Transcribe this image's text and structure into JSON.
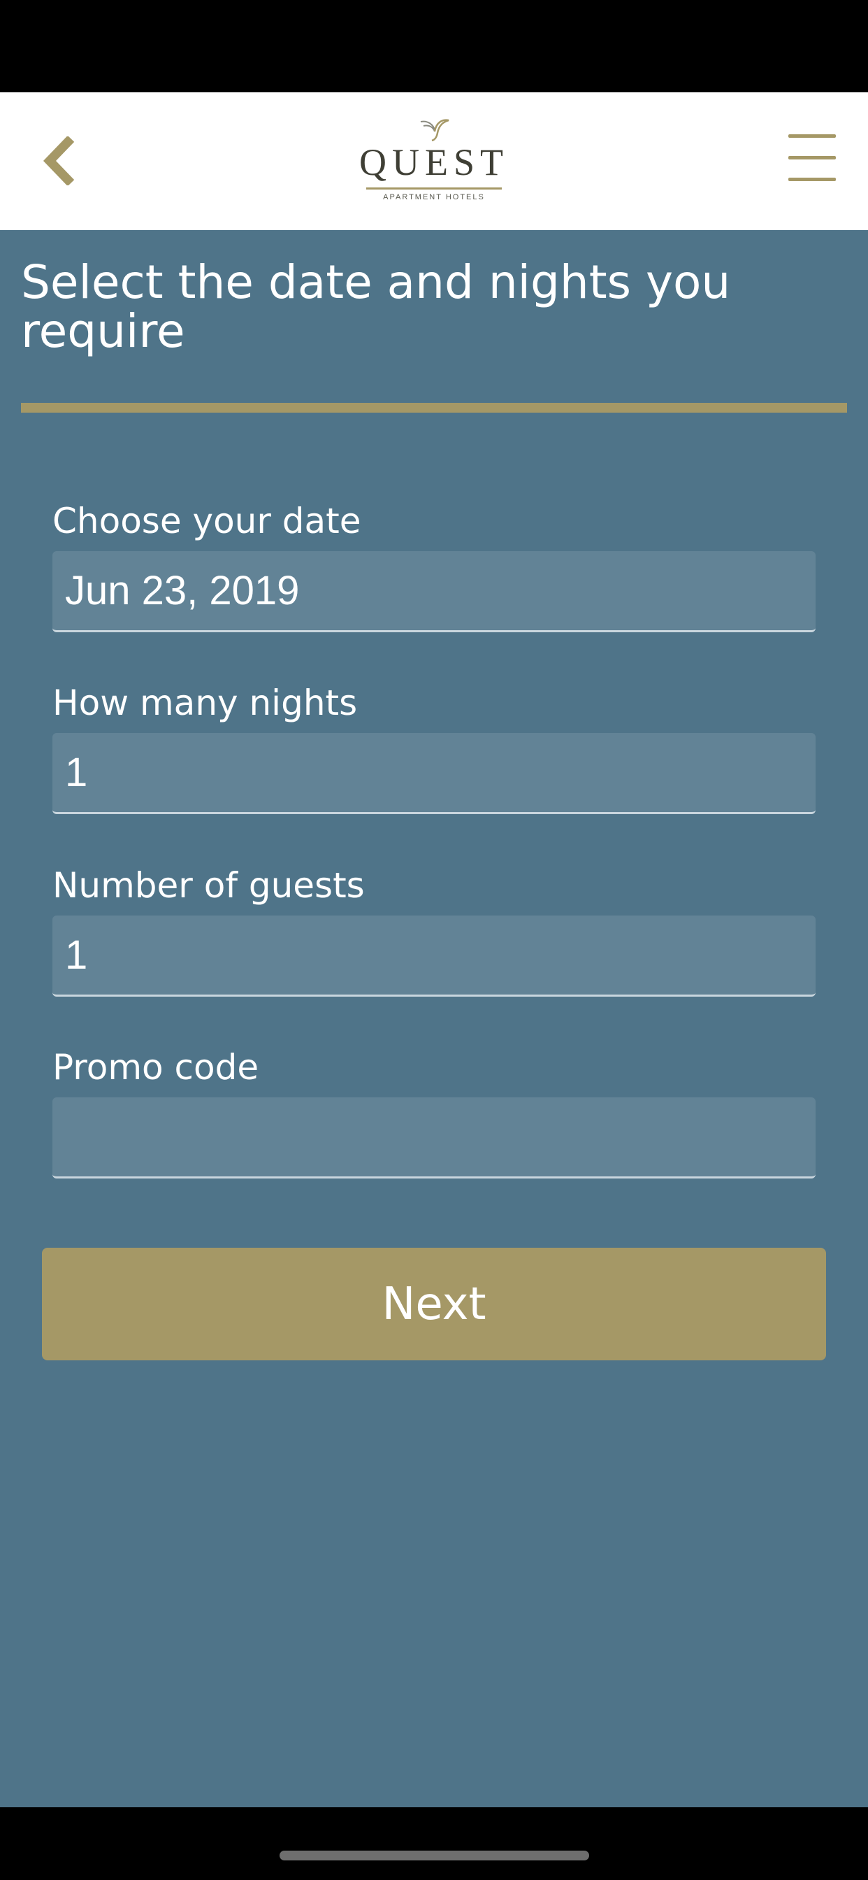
{
  "header": {
    "logo": {
      "wordmark": "QUEST",
      "subtitle": "APARTMENT HOTELS"
    },
    "back_icon": "chevron-left-icon",
    "menu_icon": "hamburger-menu-icon"
  },
  "main": {
    "title": "Select the date and nights you require",
    "fields": [
      {
        "label": "Choose your date",
        "value": "Jun 23, 2019",
        "placeholder": ""
      },
      {
        "label": "How many nights",
        "value": "1",
        "placeholder": ""
      },
      {
        "label": "Number of guests",
        "value": "1",
        "placeholder": ""
      },
      {
        "label": "Promo code",
        "value": "",
        "placeholder": ""
      }
    ],
    "next_label": "Next"
  },
  "colors": {
    "accent": "#a59866",
    "background": "#4f7489",
    "input_background": "#628396",
    "header_background": "#ffffff"
  }
}
